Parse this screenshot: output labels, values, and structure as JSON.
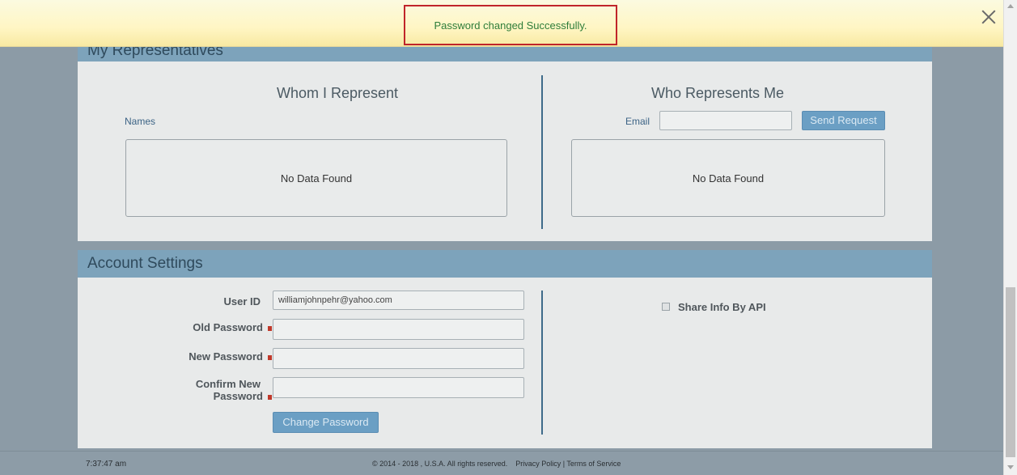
{
  "toast": {
    "message": "Password changed Successfully."
  },
  "representatives": {
    "header": "My Representatives",
    "left": {
      "title": "Whom I Represent",
      "names_label": "Names",
      "empty_text": "No Data Found"
    },
    "right": {
      "title": "Who Represents Me",
      "email_label": "Email",
      "email_value": "",
      "send_button": "Send Request",
      "empty_text": "No Data Found"
    }
  },
  "account": {
    "header": "Account Settings",
    "user_id_label": "User ID",
    "user_id_value": "williamjohnpehr@yahoo.com",
    "old_password_label": "Old Password",
    "new_password_label": "New Password",
    "confirm_password_label_1": "Confirm New",
    "confirm_password_label_2": "Password",
    "change_button": "Change Password",
    "share_api_label": "Share Info By API"
  },
  "footer": {
    "time": "7:37:47 am",
    "legal": "© 2014 - 2018 , U.S.A. All rights reserved.    Privacy Policy | Terms of Service"
  }
}
